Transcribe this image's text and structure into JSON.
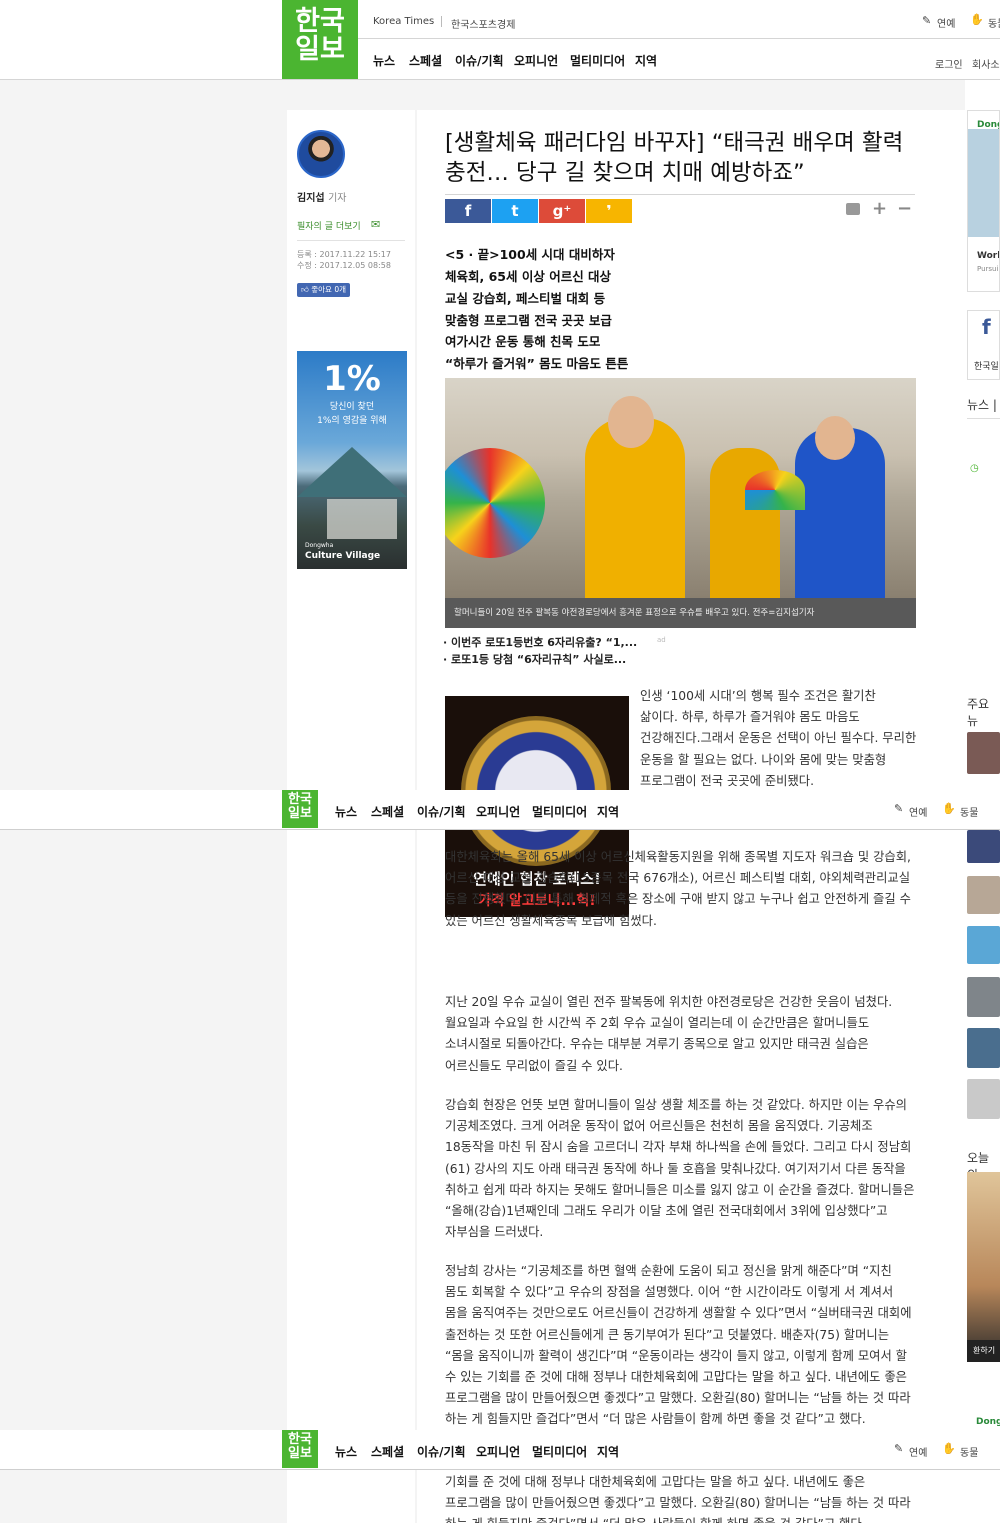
{
  "site": {
    "logo_line1": "한국",
    "logo_line2": "일보",
    "brand_en": "Korea Times",
    "brand_sports": "한국스포츠경제"
  },
  "nav": [
    "뉴스",
    "스페셜",
    "이슈/기획",
    "오피니언",
    "멀티미디어",
    "지역"
  ],
  "util": {
    "entertainment": "연예",
    "animals": "동물",
    "login": "로그인",
    "member": "회사소"
  },
  "reporter": {
    "name": "김지섭",
    "role": "기자",
    "more": "필자의 글 더보기",
    "registered": "등록 : 2017.11.22 15:17",
    "modified": "수정 : 2017.12.05 08:58",
    "like": "좋아요 0개"
  },
  "ad_left": {
    "big": "1%",
    "line1": "당신이 찾던",
    "line2": "1%의 영감을 위해",
    "brand_small": "Dongwha",
    "brand": "Culture Village"
  },
  "headline": {
    "line1": "[생활체육 패러다임 바꾸자] “태극권 배우며 활력",
    "line2": "충전… 당구 길 찾으며 치매 예방하죠”"
  },
  "share": {
    "facebook": "f",
    "twitter": "t",
    "google": "g⁺",
    "kakao": "❜"
  },
  "subtitles": [
    "<5 · 끝>100세 시대 대비하자",
    "체육회, 65세 이상 어르신 대상",
    "교실 강습회, 페스티벌 대회 등",
    "맞춤형 프로그램 전국 곳곳 보급",
    "여가시간 운동 통해 친목 도모",
    "“하루가 즐거워” 몸도 마음도 튼튼"
  ],
  "photo_caption": "할머니들이 20일 전주 팔복동 야전경로당에서 흥겨운 표정으로 우슈를 배우고 있다. 전주=김지섭기자",
  "ad_links": [
    "· 이번주 로또1등번호 6자리유출? “1,...",
    "· 로또1등 당첨 “6자리규칙” 사실로..."
  ],
  "ad_mark": "ad",
  "watch_ad": {
    "line1": "연예인 협찬 로렉스!",
    "line2": "가격 알고보니...헉!"
  },
  "paragraphs": {
    "p1": "인생 ‘100세 시대’의 행복 필수 조건은 활기찬 삶이다. 하루, 하루가 즐거워야 몸도 마음도 건강해진다.그래서 운동은 선택이 아닌 필수다. 무리한 운동을 할 필요는 없다. 나이와 몸에 맞는 맞춤형 프로그램이 전국 곳곳에 준비됐다.",
    "p2": "대한체육회는 올해 65세 이상 어르신체육활동지원을 위해 종목별 지도자 워크숍 및 강습회, 어르신 대상 교실 강습회(15종목 전국 676개소), 어르신 페스티벌 대회, 야외체력관리교실 등을 진행했다. 이를 통해 경제적 혹은 장소에 구애 받지 않고 누구나 쉽고 안전하게 즐길 수 있는 어르신 생활체육종목 보급에 힘썼다.",
    "p3": "지난 20일 우슈 교실이 열린 전주 팔복동에 위치한 야전경로당은 건강한 웃음이 넘쳤다. 월요일과 수요일 한 시간씩 주 2회 우슈 교실이 열리는데 이 순간만큼은 할머니들도 소녀시절로 되돌아간다. 우슈는 대부분 겨루기 종목으로 알고 있지만 태극권 실습은 어르신들도 무리없이 즐길 수 있다.",
    "p4": "강습회 현장은 언뜻 보면 할머니들이 일상 생활 체조를 하는 것 같았다. 하지만 이는 우슈의 기공체조였다. 크게 어려운 동작이 없어 어르신들은 천천히 몸을 움직였다. 기공체조 18동작을 마친 뒤 잠시 숨을 고르더니 각자 부채 하나씩을 손에 들었다. 그리고 다시 정남희(61) 강사의 지도 아래 태극권 동작에 하나 둘 호흡을 맞춰나갔다. 여기저기서 다른 동작을 취하고 쉽게 따라 하지는 못해도 할머니들은 미소를 잃지 않고 이 순간을 즐겼다. 할머니들은 “올해(강습)1년째인데 그래도 우리가 이달 초에 열린 전국대회에서 3위에 입상했다”고 자부심을 드러냈다.",
    "p5": "정남희 강사는 “기공체조를 하면 혈액 순환에 도움이 되고 정신을 맑게 해준다”며 “지친 몸도 회복할 수 있다”고 우슈의 장점을 설명했다. 이어 “한 시간이라도 이렇게 서 계셔서 몸을 움직여주는 것만으로도 어르신들이 건강하게 생활할 수 있다”면서 “실버태극권 대회에 출전하는 것 또한 어르신들에게 큰 동기부여가 된다”고 덧붙였다. 배춘자(75) 할머니는 “몸을 움직이니까 활력이 생긴다”며 “운동이라는 생각이 들지 않고, 이렇게 함께 모여서 할 수 있는 기회를 준 것에 대해 정부나 대한체육회에 고맙다는 말을 하고 싶다. 내년에도 좋은 프로그램을 많이 만들어줬으면 좋겠다”고 말했다. 오환길(80) 할머니는 “남들 하는 것 따라 하는 게 힘들지만 즐겁다”면서 “더 많은 사람들이 함께 하면 좋을 것 같다”고 했다.",
    "p6": "기회를 준 것에 대해 정부나 대한체육회에 고맙다는 말을 하고 싶다. 내년에도 좋은 프로그램을 많이 만들어줬으면 좋겠다”고 말했다. 오환길(80) 할머니는 “남들 하는 것 따라 하는 게 힘들지만 즐겁다”면서 “더 많은 사람들이 함께 하면 좋을 것 같다”고 했다."
  },
  "right": {
    "ad_brand": "Dong",
    "ad_title": "Worl",
    "ad_sub": "Pursui",
    "fb_label": "한국일",
    "news": "뉴스 |",
    "major": "주요뉴",
    "today": "오늘의",
    "bottom_label": "환하기",
    "ad_brand2": "Dong"
  },
  "colors": {
    "brand_green": "#4bb531",
    "facebook": "#3b5998",
    "twitter": "#1da1f2",
    "google": "#dd4b39",
    "kakao": "#f7b500"
  }
}
